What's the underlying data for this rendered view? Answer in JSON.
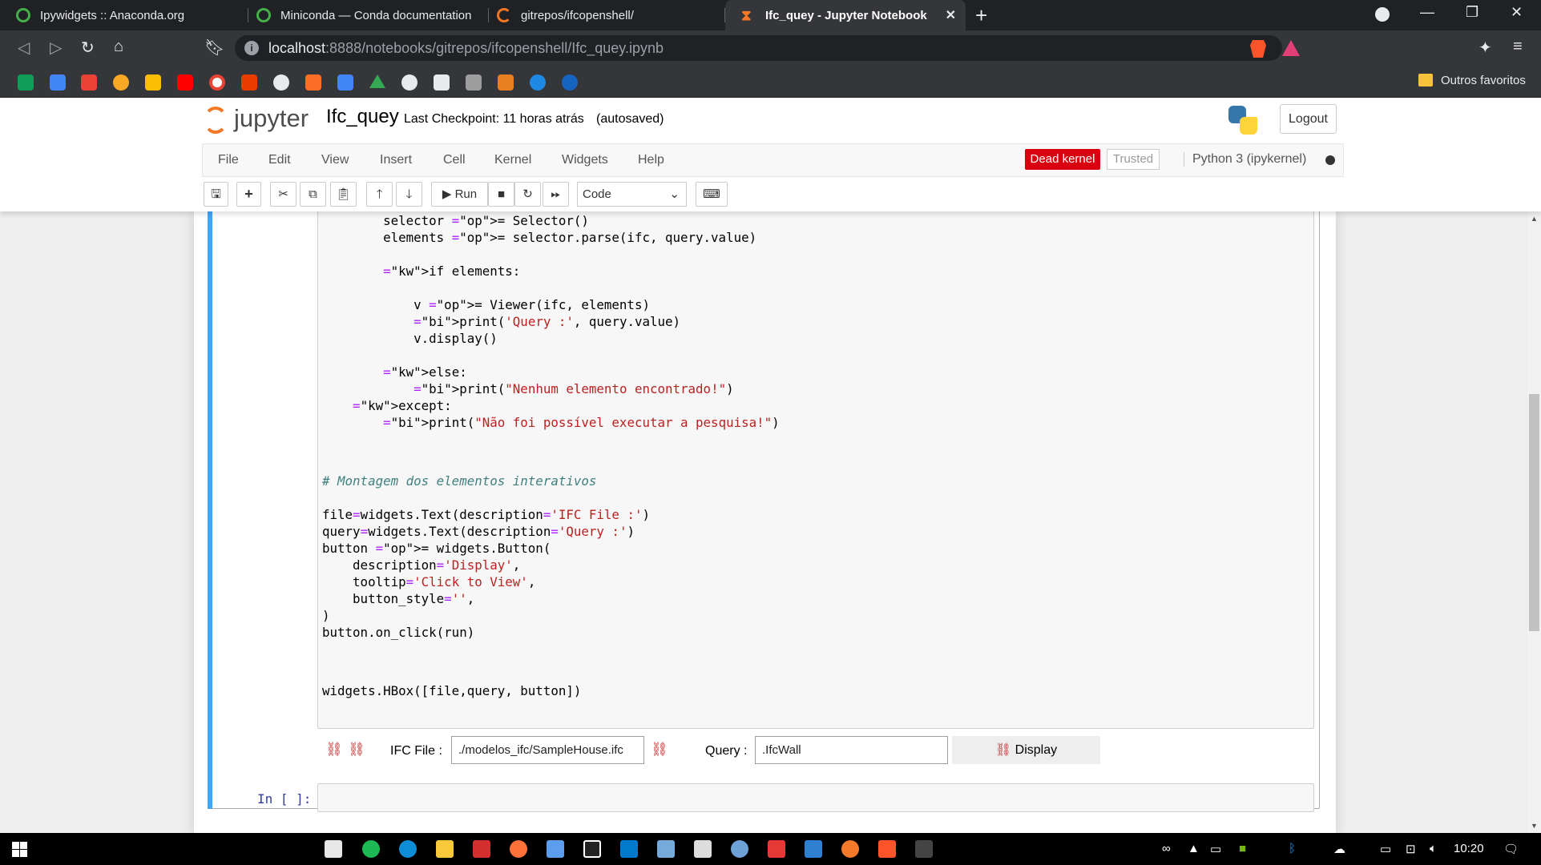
{
  "browser": {
    "tabs": [
      {
        "title": "Ipywidgets :: Anaconda.org",
        "active": false
      },
      {
        "title": "Miniconda — Conda documentation",
        "active": false
      },
      {
        "title": "gitrepos/ifcopenshell/",
        "active": false
      },
      {
        "title": "Ifc_quey - Jupyter Notebook",
        "active": true
      }
    ],
    "url_host": "localhost",
    "url_rest": ":8888/notebooks/gitrepos/ifcopenshell/Ifc_quey.ipynb",
    "bookmarks_folder": "Outros favoritos"
  },
  "jupyter": {
    "logo_text": "jupyter",
    "notebook_name": "Ifc_quey",
    "checkpoint": "Last Checkpoint: 11 horas atrás",
    "autosave": "(autosaved)",
    "logout": "Logout",
    "menu": [
      "File",
      "Edit",
      "View",
      "Insert",
      "Cell",
      "Kernel",
      "Widgets",
      "Help"
    ],
    "kernel_status": "Dead kernel",
    "trusted": "Trusted",
    "kernel_name": "Python 3 (ipykernel)",
    "toolbar": {
      "run": "Run",
      "cell_type": "Code"
    }
  },
  "cell": {
    "code_lines": [
      "        selector = Selector()",
      "        elements = selector.parse(ifc, query.value)",
      "",
      "        if elements:",
      "",
      "            v = Viewer(ifc, elements)",
      "            print('Query :', query.value)",
      "            v.display()",
      "",
      "        else:",
      "            print(\"Nenhum elemento encontrado!\")",
      "    except:",
      "        print(\"Não foi possível executar a pesquisa!\")",
      "",
      "",
      "# Montagem dos elementos interativos",
      "",
      "file=widgets.Text(description='IFC File :')",
      "query=widgets.Text(description='Query :')",
      "button = widgets.Button(",
      "    description='Display',",
      "    tooltip='Click to View',",
      "    button_style='',",
      ")",
      "button.on_click(run)",
      "",
      "",
      "widgets.HBox([file,query, button])"
    ]
  },
  "widgets": {
    "file_label": "IFC File :",
    "file_value": "./modelos_ifc/SampleHouse.ifc",
    "query_label": "Query :",
    "query_value": ".IfcWall",
    "button_label": "Display"
  },
  "next_cell": {
    "prompt": "In [ ]:"
  },
  "taskbar": {
    "time": "10:20"
  },
  "colors": {
    "accent": "#42a5f5",
    "dead_kernel": "#d9000f",
    "jupyter_orange": "#f37726"
  }
}
